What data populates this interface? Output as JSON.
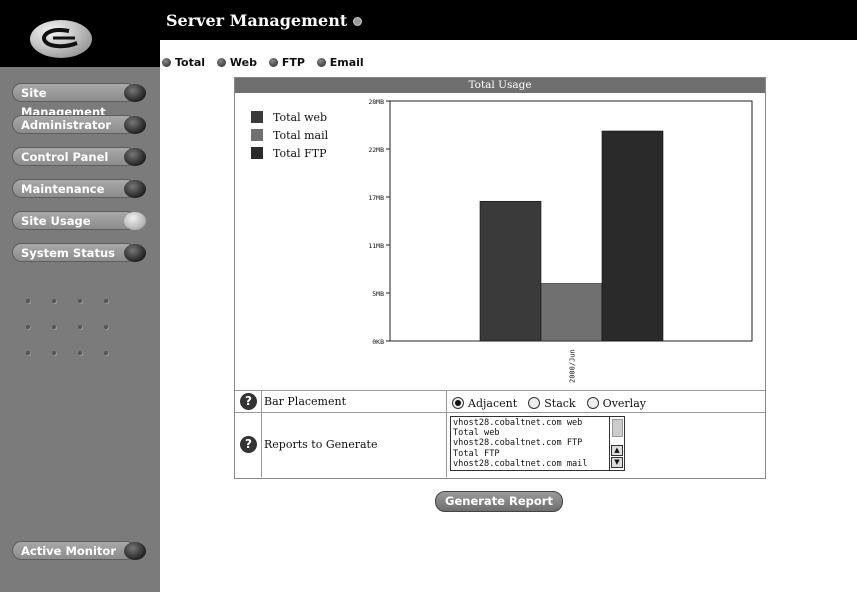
{
  "header": {
    "title": "Server Management"
  },
  "sidebar": {
    "items": [
      {
        "label": "Site Management",
        "active": false
      },
      {
        "label": "Administrator",
        "active": false
      },
      {
        "label": "Control Panel",
        "active": false
      },
      {
        "label": "Maintenance",
        "active": false
      },
      {
        "label": "Site Usage",
        "active": true
      },
      {
        "label": "System Status",
        "active": false
      }
    ],
    "bottom_item": {
      "label": "Active Monitor"
    }
  },
  "tabs": [
    "Total",
    "Web",
    "FTP",
    "Email"
  ],
  "report": {
    "panel_title": "Total Usage",
    "bar_placement": {
      "label": "Bar Placement",
      "options": [
        "Adjacent",
        "Stack",
        "Overlay"
      ],
      "selected": "Adjacent"
    },
    "reports_to_generate": {
      "label": "Reports to Generate",
      "items": [
        "vhost28.cobaltnet.com web",
        "Total web",
        "vhost28.cobaltnet.com FTP",
        "Total FTP",
        "vhost28.cobaltnet.com mail"
      ]
    },
    "generate_label": "Generate Report"
  },
  "chart_data": {
    "type": "bar",
    "title": "",
    "xlabel": "",
    "ylabel": "",
    "categories": [
      "2000/Jun"
    ],
    "series": [
      {
        "name": "Total web",
        "values": [
          16.3
        ],
        "color": "#3a3a3a"
      },
      {
        "name": "Total mail",
        "values": [
          6.7
        ],
        "color": "#707070"
      },
      {
        "name": "Total FTP",
        "values": [
          24.5
        ],
        "color": "#2a2a2a"
      }
    ],
    "yticks": [
      "0KB",
      "5MB",
      "11MB",
      "17MB",
      "22MB",
      "28MB"
    ],
    "ylim": [
      0,
      28
    ],
    "grid": false,
    "legend": "top-left"
  }
}
